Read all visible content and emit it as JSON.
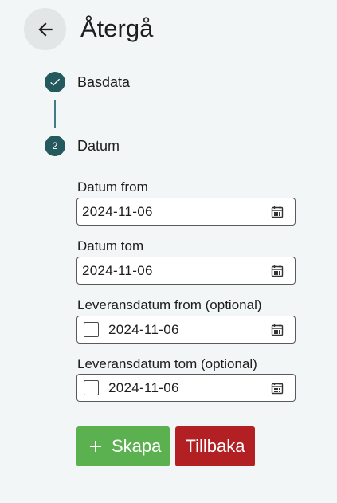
{
  "header": {
    "title": "Återgå"
  },
  "stepper": {
    "steps": [
      {
        "label": "Basdata",
        "state": "complete"
      },
      {
        "label": "Datum",
        "number": "2",
        "state": "active"
      }
    ]
  },
  "form": {
    "fields": [
      {
        "label": "Datum from",
        "value": "2024-11-06",
        "checkbox": false
      },
      {
        "label": "Datum tom",
        "value": "2024-11-06",
        "checkbox": false
      },
      {
        "label": "Leveransdatum from (optional)",
        "value": "2024-11-06",
        "checkbox": true,
        "checked": false
      },
      {
        "label": "Leveransdatum tom (optional)",
        "value": "2024-11-06",
        "checkbox": true,
        "checked": false
      }
    ]
  },
  "actions": {
    "create_label": "Skapa",
    "back_label": "Tillbaka"
  },
  "colors": {
    "background": "#f2f6f6",
    "stepper_accent": "#245a5e",
    "create_button": "#5bb14f",
    "back_button": "#b32024"
  },
  "icons": {
    "back": "arrow-left-icon",
    "step_complete": "check-icon",
    "date_picker": "calendar-icon",
    "create": "plus-icon"
  }
}
